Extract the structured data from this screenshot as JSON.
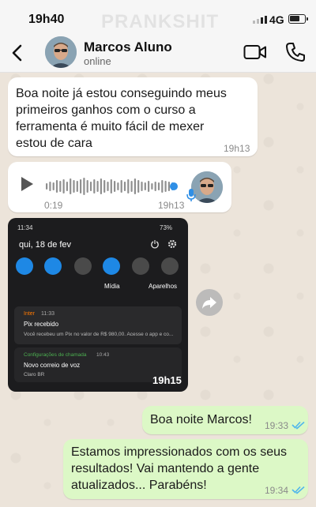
{
  "status_bar": {
    "time": "19h40",
    "watermark": "PRANKSHIT",
    "network": "4G"
  },
  "header": {
    "contact_name": "Marcos Aluno",
    "contact_status": "online"
  },
  "messages": [
    {
      "direction": "incoming",
      "lines": [
        "Boa noite já estou conseguindo meus",
        "primeiros ganhos com o curso a",
        "ferramenta é muito fácil de mexer",
        "estou de cara"
      ],
      "time": "19h13"
    },
    {
      "direction": "incoming",
      "type": "voice",
      "duration": "0:19",
      "time": "19h13"
    },
    {
      "direction": "incoming",
      "type": "image",
      "time": "19h15",
      "screenshot": {
        "clock": "11:34",
        "battery": "73%",
        "date": "qui, 18 de fev",
        "media_label": "Mídia",
        "devices_label": "Aparelhos",
        "notif1_app": "Inter",
        "notif1_time": "11:33",
        "notif1_title": "Pix recebido",
        "notif1_body": "Você recebeu um Pix no valor de R$ 980,00. Acesse o app e co...",
        "notif2_app": "Configurações de chamada",
        "notif2_time": "10:43",
        "notif2_title": "Novo correio de voz",
        "notif2_body": "Claro BR"
      }
    },
    {
      "direction": "outgoing",
      "lines": [
        "Boa noite Marcos!"
      ],
      "time": "19:33"
    },
    {
      "direction": "outgoing",
      "lines": [
        "Estamos impressionados com os seus",
        "resultados! Vai mantendo a gente",
        "atualizados... Parabéns!"
      ],
      "time": "19:34"
    }
  ],
  "colors": {
    "outgoing_bubble": "#dcf8c6",
    "incoming_bubble": "#ffffff",
    "read_ticks": "#4fb6ec",
    "voice_accent": "#2f8fe6"
  }
}
